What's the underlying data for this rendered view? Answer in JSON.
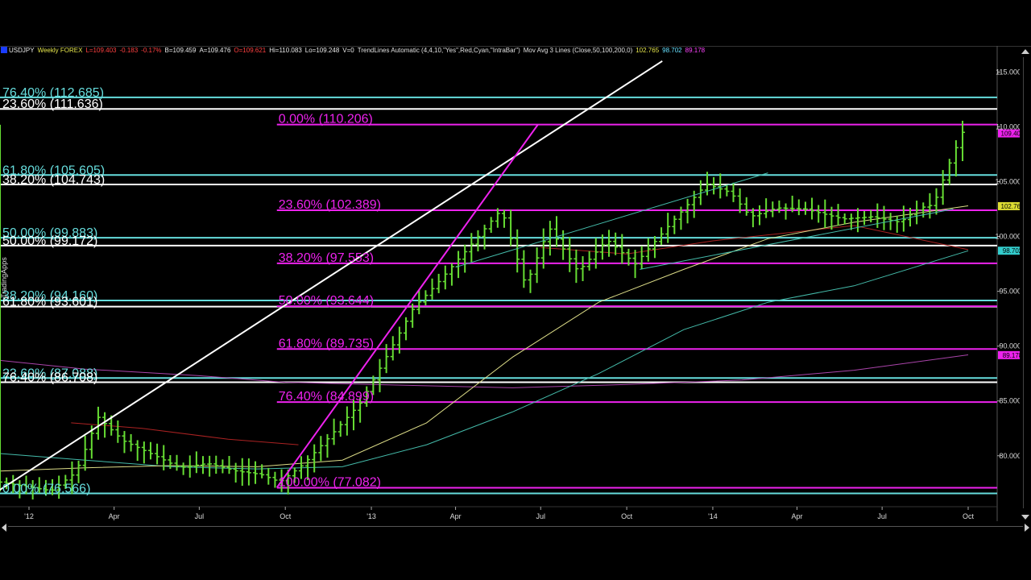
{
  "header": {
    "symbol": "USDJPY",
    "timeframe": "Weekly FOREX",
    "last": "L=109.403",
    "change": "-0.183",
    "change_pct": "-0.17%",
    "bid": "B=109.459",
    "ask": "A=109.476",
    "open": "O=109.621",
    "high": "Hi=110.083",
    "low": "Lo=109.248",
    "volume": "V=0",
    "study1": "TrendLines Automatic (4,4,10,\"Yes\",Red,Cyan,\"IntraBar\")",
    "study2": "Mov Avg 3 Lines (Close,50,100,200,0)",
    "ma1": "102.765",
    "ma2": "98.702",
    "ma3": "89.178"
  },
  "side_label": "TradingApps",
  "colors": {
    "background": "#000000",
    "bar_up": "#66dd33",
    "fib_magenta": "#ee22ee",
    "fib_cyan": "#66dddd",
    "fib_white": "#ffffff",
    "trend_white": "#ffffff",
    "trend_magenta": "#ee22ee",
    "ma_fast": "#dddd88",
    "ma_mid": "#44bbaa",
    "ma_slow": "#aa44aa",
    "ma_red": "#aa2222"
  },
  "chart_data": {
    "type": "ohlc-bar",
    "instrument": "USDJPY Weekly",
    "x_range": [
      "2011-12-01",
      "2014-11-01"
    ],
    "ylim": [
      75.5,
      116.5
    ],
    "y_ticks": [
      80,
      85,
      90,
      95,
      100,
      105,
      110,
      115
    ],
    "y_tick_labels": [
      "80.000",
      "85.000",
      "90.000",
      "95.000",
      "100.000",
      "105.000",
      "110.000",
      "115.000"
    ],
    "x_ticks": [
      {
        "date": "2012-01-01",
        "label": "'12"
      },
      {
        "date": "2012-04-01",
        "label": "Apr"
      },
      {
        "date": "2012-07-01",
        "label": "Jul"
      },
      {
        "date": "2012-10-01",
        "label": "Oct"
      },
      {
        "date": "2013-01-01",
        "label": "'13"
      },
      {
        "date": "2013-04-01",
        "label": "Apr"
      },
      {
        "date": "2013-07-01",
        "label": "Jul"
      },
      {
        "date": "2013-10-01",
        "label": "Oct"
      },
      {
        "date": "2014-01-01",
        "label": "'14"
      },
      {
        "date": "2014-04-01",
        "label": "Apr"
      },
      {
        "date": "2014-07-01",
        "label": "Jul"
      },
      {
        "date": "2014-10-01",
        "label": "Oct"
      }
    ],
    "price_path": [
      [
        "2011-12-01",
        77.6
      ],
      [
        "2012-01-25",
        76.8
      ],
      [
        "2012-02-20",
        78.5
      ],
      [
        "2012-03-15",
        83.5
      ],
      [
        "2012-04-10",
        81.4
      ],
      [
        "2012-05-15",
        80.0
      ],
      [
        "2012-06-10",
        78.9
      ],
      [
        "2012-07-10",
        79.3
      ],
      [
        "2012-08-10",
        78.6
      ],
      [
        "2012-09-05",
        78.3
      ],
      [
        "2012-09-25",
        77.6
      ],
      [
        "2012-10-20",
        79.2
      ],
      [
        "2012-11-20",
        82.0
      ],
      [
        "2012-12-20",
        84.8
      ],
      [
        "2013-01-20",
        89.5
      ],
      [
        "2013-02-15",
        93.5
      ],
      [
        "2013-03-10",
        95.5
      ],
      [
        "2013-04-15",
        99.0
      ],
      [
        "2013-05-20",
        102.5
      ],
      [
        "2013-06-15",
        95.5
      ],
      [
        "2013-07-10",
        100.8
      ],
      [
        "2013-08-10",
        96.8
      ],
      [
        "2013-09-10",
        99.7
      ],
      [
        "2013-10-10",
        97.5
      ],
      [
        "2013-11-15",
        101.0
      ],
      [
        "2013-12-25",
        104.8
      ],
      [
        "2014-01-20",
        104.0
      ],
      [
        "2014-02-10",
        101.8
      ],
      [
        "2014-03-10",
        102.6
      ],
      [
        "2014-04-10",
        102.5
      ],
      [
        "2014-05-20",
        101.6
      ],
      [
        "2014-06-20",
        101.8
      ],
      [
        "2014-07-20",
        101.3
      ],
      [
        "2014-08-10",
        102.6
      ],
      [
        "2014-08-25",
        102.9
      ],
      [
        "2014-09-10",
        106.5
      ],
      [
        "2014-09-25",
        109.5
      ],
      [
        "2014-10-01",
        109.4
      ]
    ],
    "fib_levels_magenta": [
      {
        "label": "0.00% (110.206)",
        "value": 110.206
      },
      {
        "label": "23.60% (102.389)",
        "value": 102.389
      },
      {
        "label": "38.20% (97.553)",
        "value": 97.553
      },
      {
        "label": "50.00% (93.644)",
        "value": 93.644
      },
      {
        "label": "61.80% (89.735)",
        "value": 89.735
      },
      {
        "label": "76.40% (84.899)",
        "value": 84.899
      },
      {
        "label": "100.00% (77.082)",
        "value": 77.082
      }
    ],
    "fib_levels_left": [
      {
        "label": "76.40% (112.685)",
        "value": 112.685,
        "color": "cyan"
      },
      {
        "label": "23.60% (111.636)",
        "value": 111.636,
        "color": "white"
      },
      {
        "label": "61.80% (105.605)",
        "value": 105.605,
        "color": "cyan"
      },
      {
        "label": "38.20% (104.743)",
        "value": 104.743,
        "color": "white"
      },
      {
        "label": "50.00% (99.883)",
        "value": 99.883,
        "color": "cyan"
      },
      {
        "label": "50.00% (99.172)",
        "value": 99.172,
        "color": "white"
      },
      {
        "label": "38.20% (94.160)",
        "value": 94.16,
        "color": "cyan"
      },
      {
        "label": "61.80% (93.601)",
        "value": 93.601,
        "color": "white"
      },
      {
        "label": "23.60% (87.088)",
        "value": 87.088,
        "color": "cyan"
      },
      {
        "label": "76.40% (86.708)",
        "value": 86.708,
        "color": "white"
      },
      {
        "label": "0.00% (76.566)",
        "value": 76.566,
        "color": "cyan"
      }
    ],
    "right_markers": [
      {
        "label": "109.403",
        "value": 109.403,
        "color": "#ee22ee"
      },
      {
        "label": "102.765",
        "value": 102.765,
        "color": "#dddd33"
      },
      {
        "label": "98.702",
        "value": 98.702,
        "color": "#33cccc"
      },
      {
        "label": "89.178",
        "value": 89.178,
        "color": "#ee22ee"
      }
    ]
  }
}
